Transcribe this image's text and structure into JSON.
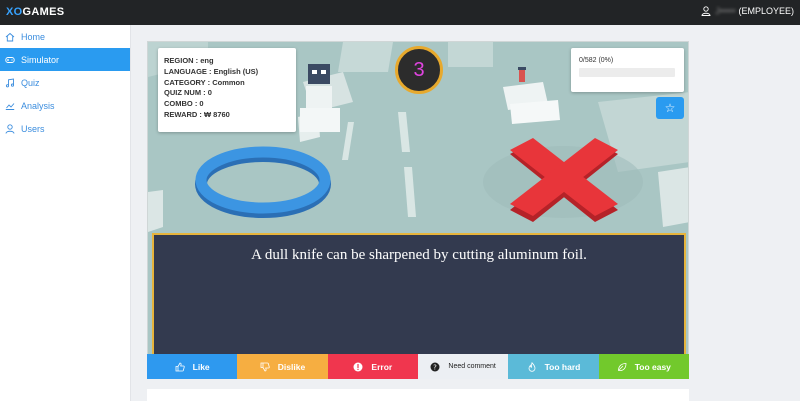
{
  "app": {
    "brand_accent": "XO",
    "brand_rest": "GAMES"
  },
  "user": {
    "name": "J•••••",
    "role": "(EMPLOYEE)"
  },
  "sidebar": {
    "items": [
      {
        "label": "Home",
        "icon": "home-icon"
      },
      {
        "label": "Simulator",
        "icon": "gamepad-icon",
        "active": true
      },
      {
        "label": "Quiz",
        "icon": "music-icon"
      },
      {
        "label": "Analysis",
        "icon": "chart-icon"
      },
      {
        "label": "Users",
        "icon": "user-icon"
      }
    ]
  },
  "game": {
    "region": "REGION : eng",
    "language": "LANGUAGE : English (US)",
    "category": "CATEGORY : Common",
    "quiz_num": "QUIZ NUM : 0",
    "combo": "COMBO : 0",
    "reward": "REWARD : ₩ 8760",
    "timer": "3",
    "progress_text": "0/582 (0%)",
    "progress_fraction": 0,
    "star_label": "☆",
    "question": "A dull knife can be sharpened by cutting aluminum foil."
  },
  "feedback": {
    "like": "Like",
    "dislike": "Dislike",
    "error": "Error",
    "need_comment": "Need comment",
    "too_hard": "Too hard",
    "too_easy": "Too easy"
  },
  "colors": {
    "accent": "#2a9bf0",
    "like": "#2e99ef",
    "dislike": "#f6ae41",
    "error": "#f0364e",
    "too_hard": "#5bbad8",
    "too_easy": "#72c92c",
    "timer_ring": "#e7a92d"
  }
}
